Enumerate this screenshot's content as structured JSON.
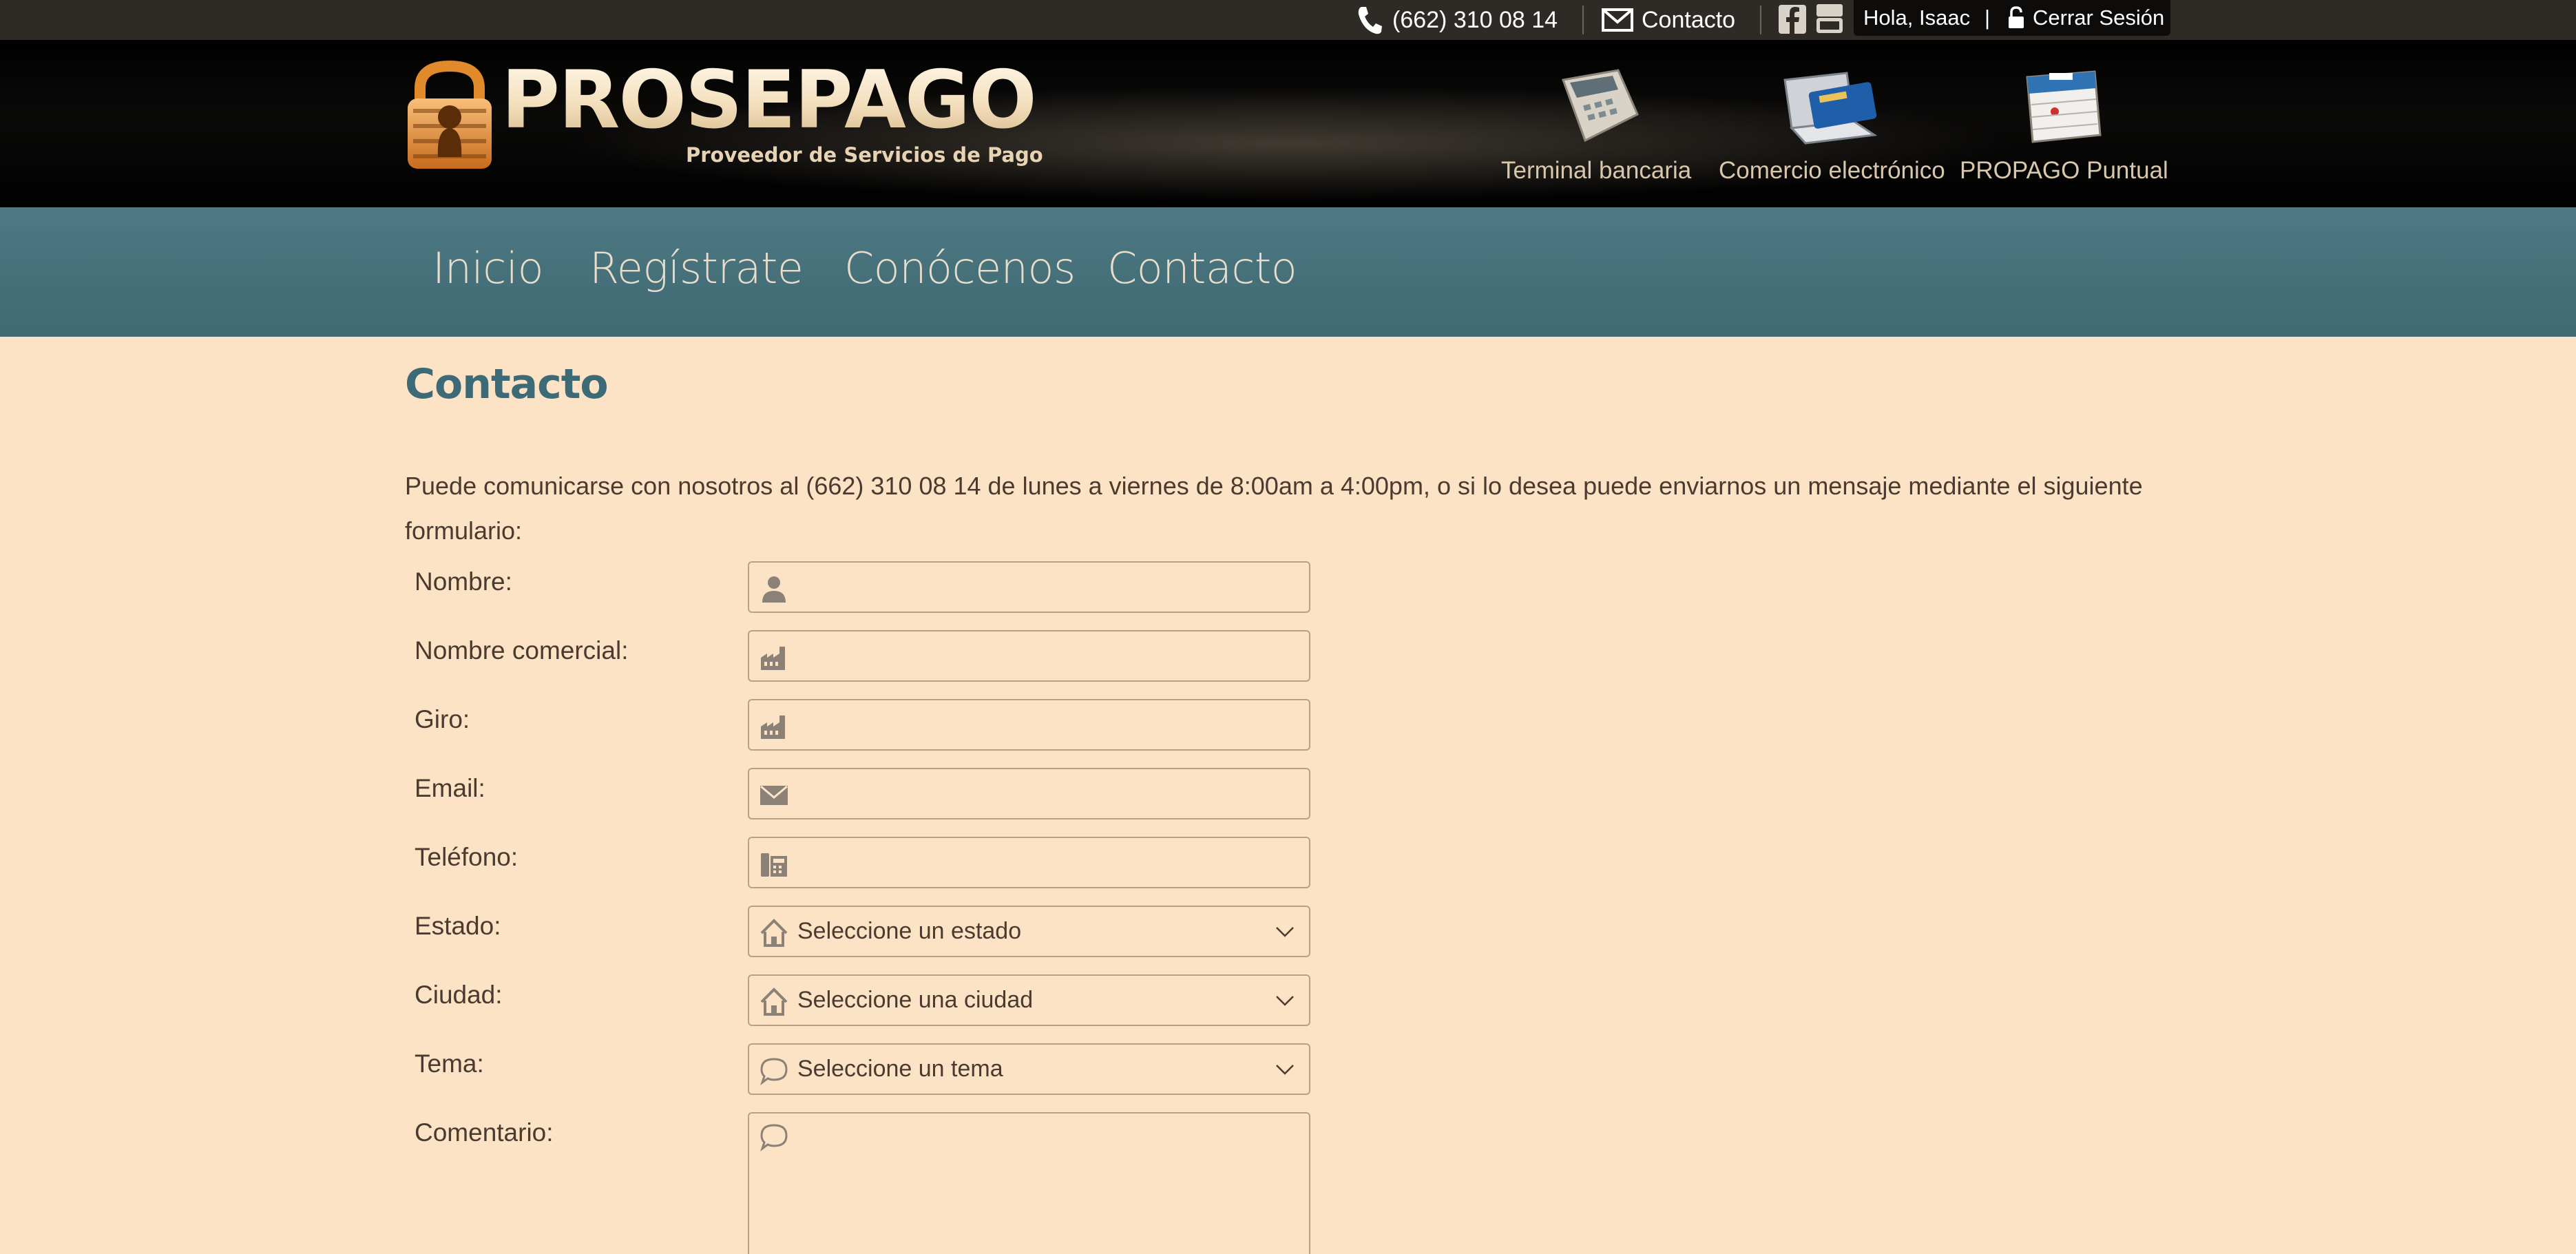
{
  "topbar": {
    "phone": "(662) 310 08 14",
    "contact": "Contacto",
    "greeting": "Hola, Isaac",
    "separator": "|",
    "logout": "Cerrar Sesión"
  },
  "brand": {
    "name": "PROSEPAGO",
    "tagline": "Proveedor de Servicios de Pago"
  },
  "services": [
    {
      "label": "Terminal bancaria",
      "icon": "card-terminal-icon"
    },
    {
      "label": "Comercio electrónico",
      "icon": "laptop-card-icon"
    },
    {
      "label": "PROPAGO Puntual",
      "icon": "calendar-icon"
    }
  ],
  "nav": {
    "items": [
      "Inicio",
      "Regístrate",
      "Conócenos",
      "Contacto"
    ]
  },
  "page": {
    "title": "Contacto",
    "intro": "Puede comunicarse con nosotros al (662) 310 08 14 de lunes a viernes de 8:00am a 4:00pm, o si lo desea puede enviarnos un mensaje mediante el siguiente formulario:"
  },
  "form": {
    "fields": [
      {
        "label": "Nombre:",
        "icon": "user-icon",
        "value": ""
      },
      {
        "label": "Nombre comercial:",
        "icon": "factory-icon",
        "value": ""
      },
      {
        "label": "Giro:",
        "icon": "factory-icon",
        "value": ""
      },
      {
        "label": "Email:",
        "icon": "envelope-icon",
        "value": ""
      },
      {
        "label": "Teléfono:",
        "icon": "phone-book-icon",
        "value": ""
      }
    ],
    "selects": [
      {
        "label": "Estado:",
        "icon": "house-icon",
        "selected": "Seleccione un estado"
      },
      {
        "label": "Ciudad:",
        "icon": "house-icon",
        "selected": "Seleccione una ciudad"
      },
      {
        "label": "Tema:",
        "icon": "speech-bubble-icon",
        "selected": "Seleccione un tema"
      }
    ],
    "comment": {
      "label": "Comentario:",
      "icon": "speech-bubble-icon",
      "value": ""
    }
  },
  "colors": {
    "background": "#fde3c5",
    "topbar": "#2e2b27",
    "nav": "#46717b",
    "title": "#3c6a76",
    "accent_orange": "#e08a2c"
  }
}
